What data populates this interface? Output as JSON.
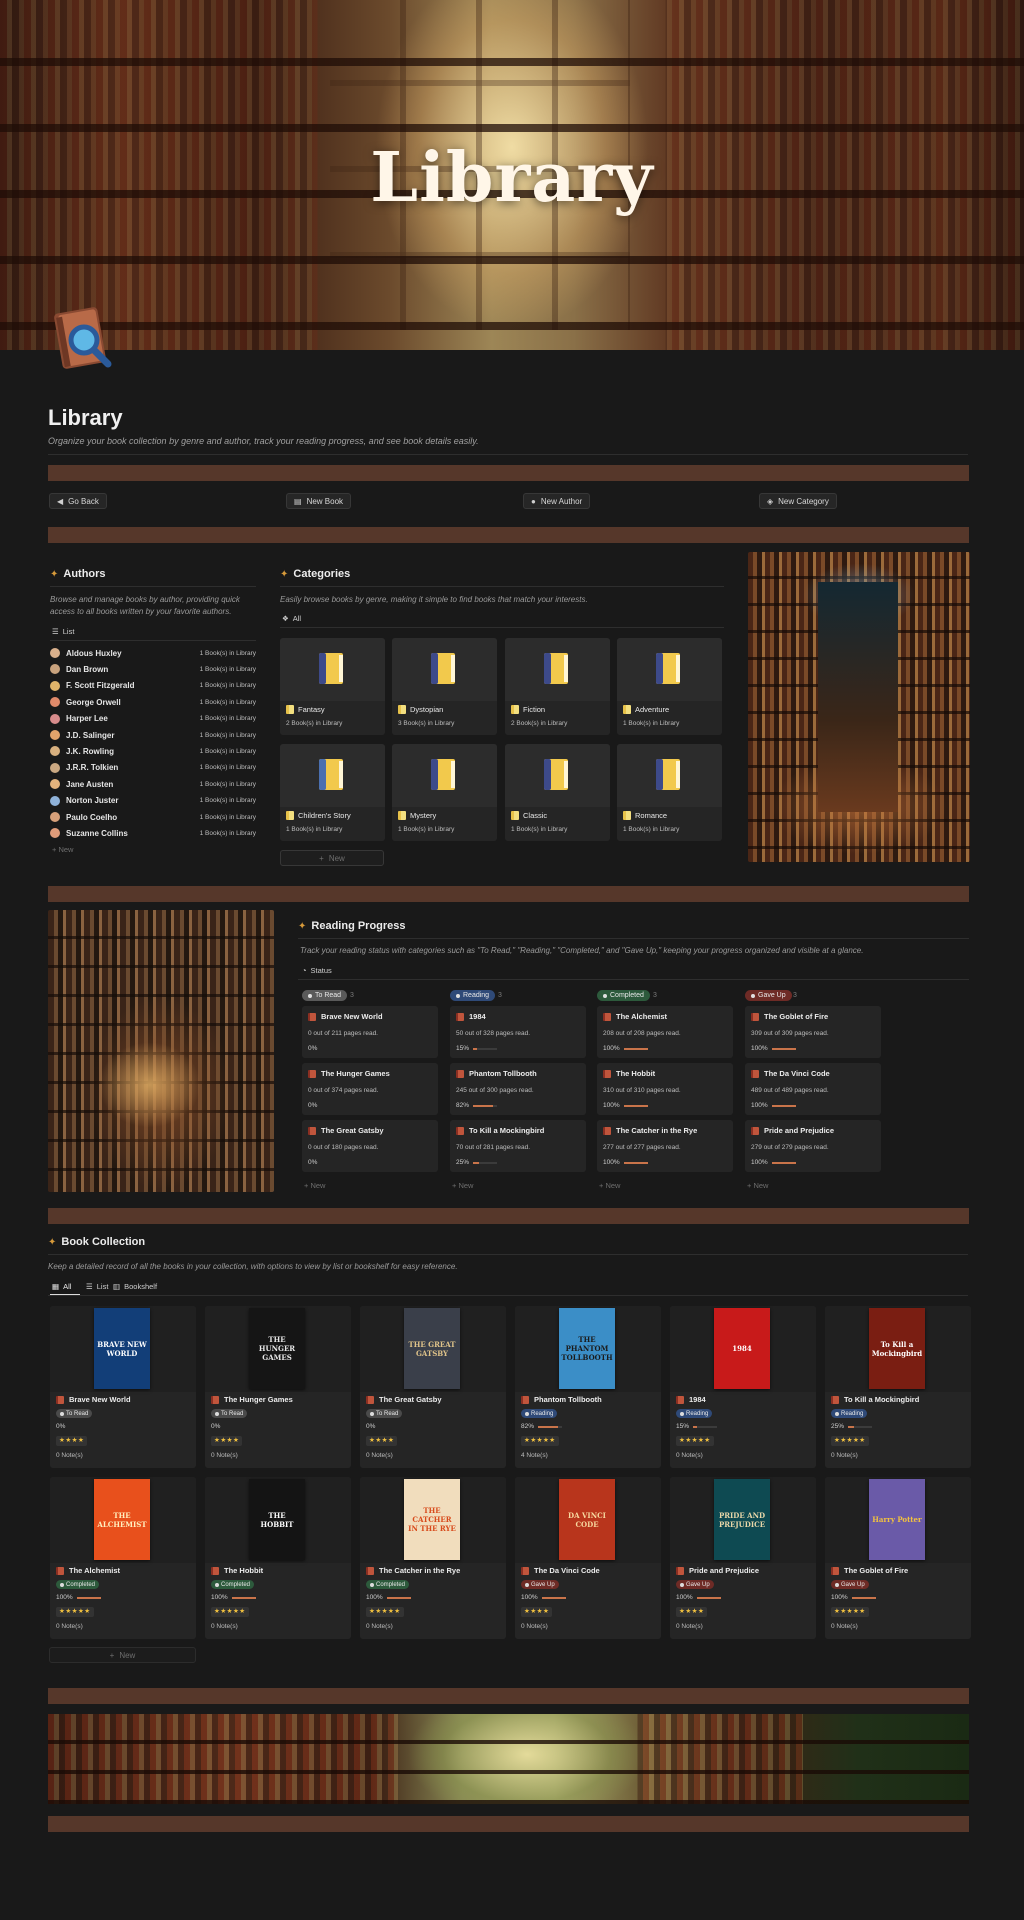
{
  "cover": {
    "title": "Library"
  },
  "page": {
    "title": "Library",
    "description": "Organize your book collection by genre and author, track your reading progress, and see book details easily."
  },
  "toolbar": {
    "go_back": "Go Back",
    "new_book": "New Book",
    "new_author": "New Author",
    "new_category": "New Category"
  },
  "authors": {
    "heading": "Authors",
    "description": "Browse and manage books by author, providing quick access to all books written by your favorite authors.",
    "view_label": "List",
    "new_label": "New",
    "items": [
      {
        "name": "Aldous Huxley",
        "count": "1 Book(s) in Library",
        "color": "#d9b08c"
      },
      {
        "name": "Dan Brown",
        "count": "1 Book(s) in Library",
        "color": "#c9a37e"
      },
      {
        "name": "F. Scott Fitzgerald",
        "count": "1 Book(s) in Library",
        "color": "#e0b46a"
      },
      {
        "name": "George Orwell",
        "count": "1 Book(s) in Library",
        "color": "#e08a6a"
      },
      {
        "name": "Harper Lee",
        "count": "1 Book(s) in Library",
        "color": "#d88c8c"
      },
      {
        "name": "J.D. Salinger",
        "count": "1 Book(s) in Library",
        "color": "#e2a36b"
      },
      {
        "name": "J.K. Rowling",
        "count": "1 Book(s) in Library",
        "color": "#d8b07f"
      },
      {
        "name": "J.R.R. Tolkien",
        "count": "1 Book(s) in Library",
        "color": "#caa882"
      },
      {
        "name": "Jane Austen",
        "count": "1 Book(s) in Library",
        "color": "#e3b27c"
      },
      {
        "name": "Norton Juster",
        "count": "1 Book(s) in Library",
        "color": "#8fb2d9"
      },
      {
        "name": "Paulo Coelho",
        "count": "1 Book(s) in Library",
        "color": "#d6a07a"
      },
      {
        "name": "Suzanne Collins",
        "count": "1 Book(s) in Library",
        "color": "#e09c7a"
      }
    ]
  },
  "categories": {
    "heading": "Categories",
    "description": "Easily browse books by genre, making it simple to find books that match your interests.",
    "view_label": "All",
    "new_label": "New",
    "items": [
      {
        "name": "Fantasy",
        "count": "2 Book(s) in Library",
        "icon": "book-icon"
      },
      {
        "name": "Dystopian",
        "count": "3 Book(s) in Library",
        "icon": "sad-book-icon"
      },
      {
        "name": "Fiction",
        "count": "2 Book(s) in Library",
        "icon": "book-icon"
      },
      {
        "name": "Adventure",
        "count": "1 Book(s) in Library",
        "icon": "adventure-book-icon"
      },
      {
        "name": "Children's Story",
        "count": "1 Book(s) in Library",
        "icon": "abc-blocks-icon"
      },
      {
        "name": "Mystery",
        "count": "1 Book(s) in Library",
        "icon": "mystery-book-icon"
      },
      {
        "name": "Classic",
        "count": "1 Book(s) in Library",
        "icon": "book-icon"
      },
      {
        "name": "Romance",
        "count": "1 Book(s) in Library",
        "icon": "heart-book-icon"
      }
    ]
  },
  "progress": {
    "heading": "Reading Progress",
    "description": "Track your reading status with categories such as \"To Read,\" \"Reading,\" \"Completed,\" and \"Gave Up,\" keeping your progress organized and visible at a glance.",
    "view_label": "Status",
    "new_label": "New",
    "lanes": [
      {
        "label": "To Read",
        "count": "3",
        "color": "#5a5a5a",
        "cards": [
          {
            "title": "Brave New World",
            "pages": "0 out of 211 pages read.",
            "pct": "0%",
            "fraction": 0
          },
          {
            "title": "The Hunger Games",
            "pages": "0 out of 374 pages read.",
            "pct": "0%",
            "fraction": 0
          },
          {
            "title": "The Great Gatsby",
            "pages": "0 out of 180 pages read.",
            "pct": "0%",
            "fraction": 0
          }
        ]
      },
      {
        "label": "Reading",
        "count": "3",
        "color": "#2f4a78",
        "cards": [
          {
            "title": "1984",
            "pages": "50 out of 328 pages read.",
            "pct": "15%",
            "fraction": 0.15
          },
          {
            "title": "Phantom Tollbooth",
            "pages": "245 out of 300 pages read.",
            "pct": "82%",
            "fraction": 0.82
          },
          {
            "title": "To Kill a Mockingbird",
            "pages": "70 out of 281 pages read.",
            "pct": "25%",
            "fraction": 0.25
          }
        ]
      },
      {
        "label": "Completed",
        "count": "3",
        "color": "#2d5a3c",
        "cards": [
          {
            "title": "The Alchemist",
            "pages": "208 out of 208 pages read.",
            "pct": "100%",
            "fraction": 1
          },
          {
            "title": "The Hobbit",
            "pages": "310 out of 310 pages read.",
            "pct": "100%",
            "fraction": 1
          },
          {
            "title": "The Catcher in the Rye",
            "pages": "277 out of 277 pages read.",
            "pct": "100%",
            "fraction": 1
          }
        ]
      },
      {
        "label": "Gave Up",
        "count": "3",
        "color": "#6e2b26",
        "cards": [
          {
            "title": "The Goblet of Fire",
            "pages": "309 out of 309 pages read.",
            "pct": "100%",
            "fraction": 1
          },
          {
            "title": "The Da Vinci Code",
            "pages": "489 out of 489 pages read.",
            "pct": "100%",
            "fraction": 1
          },
          {
            "title": "Pride and Prejudice",
            "pages": "279 out of 279 pages read.",
            "pct": "100%",
            "fraction": 1
          }
        ]
      }
    ]
  },
  "collection": {
    "heading": "Book Collection",
    "description": "Keep a detailed record of all the books in your collection, with options to view by list or bookshelf for easy reference.",
    "tabs": [
      "All",
      "List",
      "Bookshelf"
    ],
    "new_label": "New",
    "books": [
      {
        "title": "Brave New World",
        "status": "To Read",
        "status_color": "#4a4a4a",
        "pct": "0%",
        "fraction": 0,
        "stars": "★★★★",
        "notes": "0 Note(s)",
        "cover_bg": "#123e78",
        "cover_fg": "#ffffff",
        "cover_text": "BRAVE NEW WORLD"
      },
      {
        "title": "The Hunger Games",
        "status": "To Read",
        "status_color": "#4a4a4a",
        "pct": "0%",
        "fraction": 0,
        "stars": "★★★★",
        "notes": "0 Note(s)",
        "cover_bg": "#151515",
        "cover_fg": "#e8e8e8",
        "cover_text": "THE HUNGER GAMES"
      },
      {
        "title": "The Great Gatsby",
        "status": "To Read",
        "status_color": "#4a4a4a",
        "pct": "0%",
        "fraction": 0,
        "stars": "★★★★",
        "notes": "0 Note(s)",
        "cover_bg": "#3a3f4a",
        "cover_fg": "#e0c48a",
        "cover_text": "THE GREAT GATSBY"
      },
      {
        "title": "Phantom Tollbooth",
        "status": "Reading",
        "status_color": "#2f4a78",
        "pct": "82%",
        "fraction": 0.82,
        "stars": "★★★★★",
        "notes": "4 Note(s)",
        "cover_bg": "#3b8ec7",
        "cover_fg": "#1b1b1b",
        "cover_text": "THE PHANTOM TOLLBOOTH"
      },
      {
        "title": "1984",
        "status": "Reading",
        "status_color": "#2f4a78",
        "pct": "15%",
        "fraction": 0.15,
        "stars": "★★★★★",
        "notes": "0 Note(s)",
        "cover_bg": "#c81a1a",
        "cover_fg": "#ffffff",
        "cover_text": "1984"
      },
      {
        "title": "To Kill a Mockingbird",
        "status": "Reading",
        "status_color": "#2f4a78",
        "pct": "25%",
        "fraction": 0.25,
        "stars": "★★★★★",
        "notes": "0 Note(s)",
        "cover_bg": "#7a1e12",
        "cover_fg": "#ffffff",
        "cover_text": "To Kill a Mockingbird"
      },
      {
        "title": "The Alchemist",
        "status": "Completed",
        "status_color": "#2d5a3c",
        "pct": "100%",
        "fraction": 1,
        "stars": "★★★★★",
        "notes": "0 Note(s)",
        "cover_bg": "#e8501c",
        "cover_fg": "#fff0c0",
        "cover_text": "THE ALCHEMIST"
      },
      {
        "title": "The Hobbit",
        "status": "Completed",
        "status_color": "#2d5a3c",
        "pct": "100%",
        "fraction": 1,
        "stars": "★★★★★",
        "notes": "0 Note(s)",
        "cover_bg": "#141414",
        "cover_fg": "#ffffff",
        "cover_text": "THE HOBBIT"
      },
      {
        "title": "The Catcher in the Rye",
        "status": "Completed",
        "status_color": "#2d5a3c",
        "pct": "100%",
        "fraction": 1,
        "stars": "★★★★★",
        "notes": "0 Note(s)",
        "cover_bg": "#f1ddbd",
        "cover_fg": "#d84a1b",
        "cover_text": "THE CATCHER IN THE RYE"
      },
      {
        "title": "The Da Vinci Code",
        "status": "Gave Up",
        "status_color": "#6e2b26",
        "pct": "100%",
        "fraction": 1,
        "stars": "★★★★",
        "notes": "0 Note(s)",
        "cover_bg": "#b8351c",
        "cover_fg": "#f7d9a0",
        "cover_text": "DA VINCI CODE"
      },
      {
        "title": "Pride and Prejudice",
        "status": "Gave Up",
        "status_color": "#6e2b26",
        "pct": "100%",
        "fraction": 1,
        "stars": "★★★★",
        "notes": "0 Note(s)",
        "cover_bg": "#0e4a52",
        "cover_fg": "#e8d6a8",
        "cover_text": "PRIDE AND PREJUDICE"
      },
      {
        "title": "The Goblet of Fire",
        "status": "Gave Up",
        "status_color": "#6e2b26",
        "pct": "100%",
        "fraction": 1,
        "stars": "★★★★★",
        "notes": "0 Note(s)",
        "cover_bg": "#6a5aa8",
        "cover_fg": "#f3c23f",
        "cover_text": "Harry Potter"
      }
    ]
  },
  "colors": {
    "background": "#191919",
    "brown_bar": "#56372a",
    "card": "#252525",
    "accent": "#d79a3a",
    "progress_fill": "#c9744a"
  }
}
